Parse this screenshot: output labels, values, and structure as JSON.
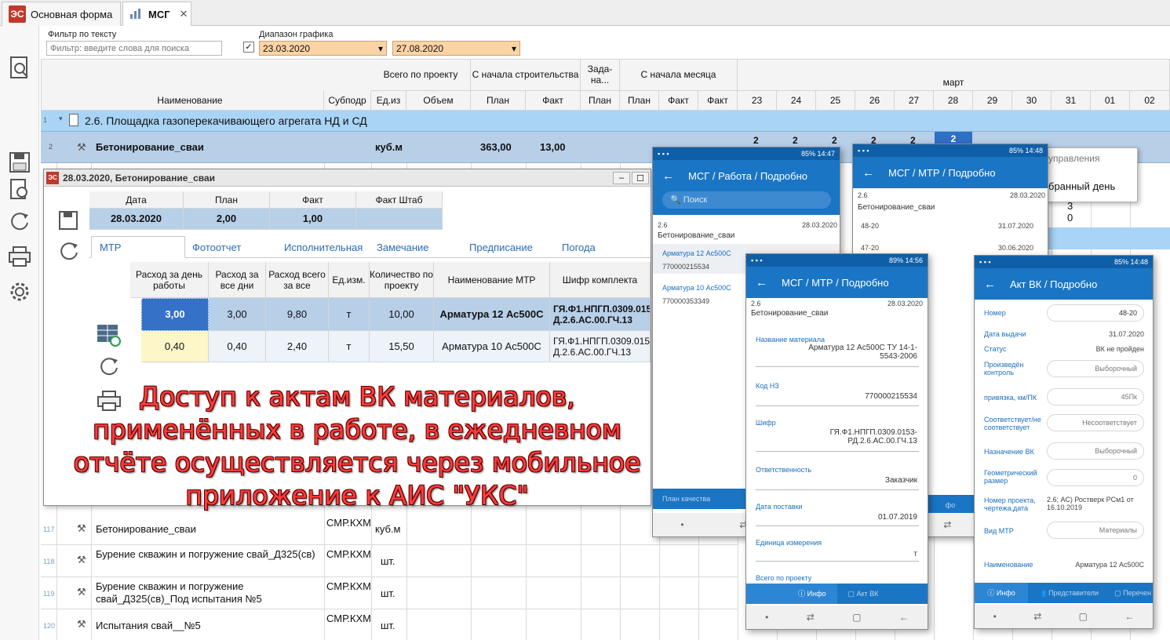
{
  "tabs": [
    {
      "label": "Основная форма",
      "logo": "ЭС"
    },
    {
      "label": "МСГ",
      "close": "✕"
    }
  ],
  "filters": {
    "text_label": "Фильтр по тексту",
    "text_placeholder": "Фильтр: введите слова для поиска",
    "range_label": "Диапазон графика",
    "range_checked": true,
    "date_from": "23.03.2020",
    "date_to": "27.08.2020"
  },
  "grid": {
    "group_headers": {
      "total": "Всего по проекту",
      "since_start": "С начала строительства",
      "task": "Зада-на...",
      "since_month": "С начала месяца",
      "month": "март"
    },
    "columns": [
      "Наименование",
      "Субподр",
      "Ед.из",
      "Объем",
      "План",
      "Факт",
      "План",
      "План",
      "Факт",
      "Факт"
    ],
    "days": [
      "23",
      "24",
      "25",
      "26",
      "27",
      "28",
      "29",
      "30",
      "31",
      "01",
      "02"
    ],
    "rows": [
      {
        "num": "1",
        "name": "2.6. Площадка газоперекачивающего агрегата НД и СД"
      },
      {
        "num": "2",
        "name": "Бетонирование_сваи",
        "unit": "куб.м",
        "plan": "363,00",
        "fact": "13,00",
        "days": [
          "2",
          "2",
          "2",
          "2",
          "2",
          "2"
        ]
      },
      {
        "num": "117",
        "name": "Бетонирование_сваи",
        "sub": "СМР.КХМ",
        "unit": "куб.м"
      },
      {
        "num": "118",
        "name": "Бурение скважин и погружение свай_Д325(св)",
        "sub": "СМР.КХМ",
        "unit": "шт."
      },
      {
        "num": "119",
        "name": "Бурение скважин и погружение свай_Д325(св)_Под испытания №5",
        "sub": "СМР.КХМ",
        "unit": "шт."
      },
      {
        "num": "120",
        "name": "Испытания свай__№5",
        "sub": "СМР.КХМ",
        "unit": "шт."
      }
    ],
    "popup_menu": {
      "item1": "управления",
      "item2": "бранный день"
    },
    "side_values": [
      "3",
      "0"
    ]
  },
  "dialog": {
    "title": "28.03.2020, Бетонирование_сваи",
    "summary_headers": [
      "Дата",
      "План",
      "Факт",
      "Факт Штаб"
    ],
    "summary_values": [
      "28.03.2020",
      "2,00",
      "1,00",
      ""
    ],
    "tabs": [
      "МТР",
      "Фотоотчет",
      "Исполнительная",
      "Замечание",
      "Предписание",
      "Погода"
    ],
    "mtr_headers": [
      "Расход за день работы",
      "Расход за все дни",
      "Расход всего за все",
      "Ед.изм.",
      "Количество по проекту",
      "Наименование МТР",
      "Шифр комплекта"
    ],
    "mtr_rows": [
      [
        "3,00",
        "3,00",
        "9,80",
        "т",
        "10,00",
        "Арматура 12 Ас500С",
        "ГЯ.Ф1.НПГП.0309.015 Д.2.6.АС.00.ГЧ.13"
      ],
      [
        "0,40",
        "0,40",
        "2,40",
        "т",
        "15,50",
        "Арматура 10 Ас500С",
        "ГЯ.Ф1.НПГП.0309.015 Д.2.6.АС.00.ГЧ.13"
      ]
    ]
  },
  "caption": "Доступ к актам ВК материалов, применённых в работе, в ежедневном отчёте осуществляется через мобильное приложение к АИС \"УКС\"",
  "phone1": {
    "status_time": "85% 14:47",
    "title": "МСГ / Работа / Подробно",
    "search": "Поиск",
    "code": "2.6",
    "date": "28.03.2020",
    "name": "Бетонирование_сваи",
    "items": [
      {
        "title": "Арматура 12 Ас500С",
        "code": "770000215534"
      },
      {
        "title": "Арматура 10 Ас500С",
        "code": "770000353349"
      }
    ],
    "bottom": "План качества"
  },
  "phone2": {
    "status_time": "85% 14:48",
    "title": "МСГ / МТР / Подробно",
    "code": "2.6",
    "date": "28.03.2020",
    "name": "Бетонирование_сваи",
    "items": [
      {
        "left": "48-20",
        "right": "31.07.2020"
      },
      {
        "left": "47-20",
        "right": "30.06.2020"
      }
    ],
    "bottom": "фо"
  },
  "phone3": {
    "status_time": "89% 14:56",
    "title": "МСГ / МТР / Подробно",
    "code": "2.6",
    "date": "28.03.2020",
    "name": "Бетонирование_сваи",
    "fields": [
      {
        "label": "Название материала",
        "value": "Арматура 12 Ас500С ТУ 14-1-5543-2006"
      },
      {
        "label": "Код НЗ",
        "value": "770000215534"
      },
      {
        "label": "Шифр",
        "value": "ГЯ.Ф1.НПГП.0309.0153-РД.2.6.АС.00.ГЧ.13"
      },
      {
        "label": "Ответственность",
        "value": "Заказчик"
      },
      {
        "label": "Дата поставки",
        "value": "01.07.2019"
      },
      {
        "label": "Единица измерения",
        "value": "т"
      },
      {
        "label": "Всего по проекту",
        "value": ""
      }
    ],
    "tabs": [
      "Инфо",
      "Акт ВК"
    ]
  },
  "phone4": {
    "status_time": "85% 14:48",
    "title": "Акт ВК / Подробно",
    "fields": [
      {
        "label": "Номер",
        "value": "48-20"
      },
      {
        "label": "Дата выдачи",
        "value": "31.07.2020"
      },
      {
        "label": "Статус",
        "value": "ВК не пройден"
      },
      {
        "label": "Произведён контроль",
        "value": "Выборочный"
      },
      {
        "label": "привязка, км/ПК",
        "value": "45Пк"
      },
      {
        "label": "Соответствует/не соответствует",
        "value": "Несоответствует"
      },
      {
        "label": "Назначение ВК",
        "value": "Выборочный"
      },
      {
        "label": "Геометрический размер",
        "value": "0"
      },
      {
        "label": "Номер проекта, чертежа,дата",
        "value": "2.6; АС) Ростверк РСм1 от 16.10.2019"
      },
      {
        "label": "Вид МТР",
        "value": "Материалы"
      },
      {
        "label": "Наименование",
        "value": "Арматура 12 Ас500С"
      }
    ],
    "tabs": [
      "Инфо",
      "Представители",
      "Перечен"
    ]
  },
  "colors": {
    "accent": "#1a75c4",
    "group_row": "#aad4f5",
    "selected_row": "#b8cfe8",
    "caption": "#ff3b3b"
  }
}
